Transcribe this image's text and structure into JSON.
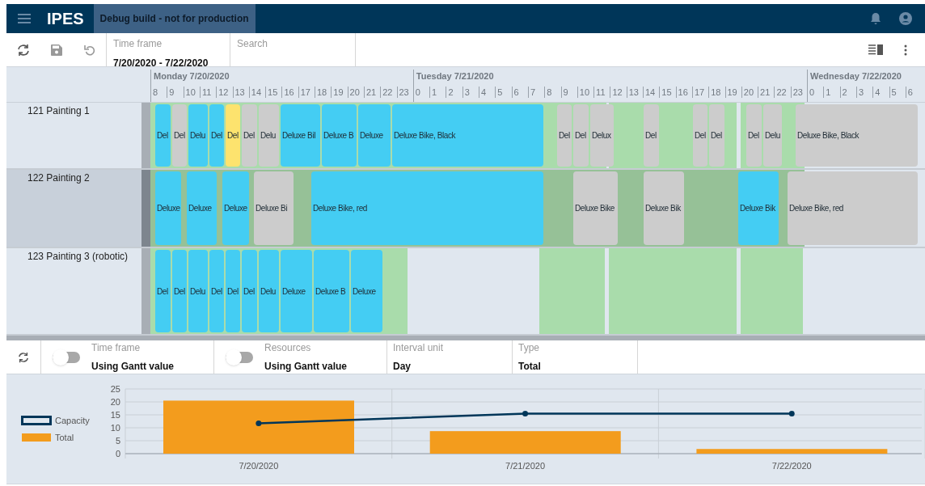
{
  "app_bar": {
    "title": "IPES",
    "badge": "Debug build - not for production"
  },
  "toolbar": {
    "time_frame": {
      "label": "Time frame",
      "value": "7/20/2020 - 7/22/2020"
    },
    "search": {
      "placeholder": "Search"
    }
  },
  "timeline": {
    "days": [
      "Monday 7/20/2020",
      "Tuesday 7/21/2020",
      "Wednesday 7/22/2020"
    ],
    "hours": [
      "8",
      "9",
      "10",
      "11",
      "12",
      "13",
      "14",
      "15",
      "16",
      "17",
      "18",
      "19",
      "20",
      "21",
      "22",
      "23",
      "0",
      "1",
      "2",
      "3",
      "4",
      "5",
      "6",
      "7",
      "8",
      "9",
      "10",
      "11",
      "12",
      "13",
      "14",
      "15",
      "16",
      "17",
      "18",
      "19",
      "20",
      "21",
      "22",
      "23",
      "0",
      "1",
      "2",
      "3",
      "4",
      "5",
      "6"
    ]
  },
  "resources": [
    {
      "name": "121 Painting 1",
      "selected": false,
      "tasks": [
        {
          "label": "Del",
          "color": "#44cdf3"
        },
        {
          "label": "Del",
          "color": "#cccccc"
        },
        {
          "label": "Delu",
          "color": "#44cdf3"
        },
        {
          "label": "Del",
          "color": "#44cdf3"
        },
        {
          "label": "Del",
          "color": "#fde36e"
        },
        {
          "label": "Del",
          "color": "#cccccc"
        },
        {
          "label": "Delu",
          "color": "#cccccc"
        },
        {
          "label": "Deluxe Bil",
          "color": "#44cdf3"
        },
        {
          "label": "Deluxe B",
          "color": "#44cdf3"
        },
        {
          "label": "Deluxe",
          "color": "#44cdf3"
        },
        {
          "label": "Deluxe Bike, Black",
          "color": "#44cdf3"
        },
        {
          "label": "Del",
          "color": "#cccccc"
        },
        {
          "label": "Del",
          "color": "#cccccc"
        },
        {
          "label": "Delux",
          "color": "#cccccc"
        },
        {
          "label": "Del",
          "color": "#cccccc"
        },
        {
          "label": "Del",
          "color": "#cccccc"
        },
        {
          "label": "Del",
          "color": "#cccccc"
        },
        {
          "label": "Del",
          "color": "#cccccc"
        },
        {
          "label": "Delu",
          "color": "#cccccc"
        },
        {
          "label": "Deluxe Bike, Black",
          "color": "#cccccc"
        }
      ]
    },
    {
      "name": "122 Painting 2",
      "selected": true,
      "tasks": [
        {
          "label": "Deluxe",
          "color": "#44cdf3"
        },
        {
          "label": "Deluxe",
          "color": "#44cdf3"
        },
        {
          "label": "Deluxe",
          "color": "#44cdf3"
        },
        {
          "label": "Deluxe Bi",
          "color": "#cccccc"
        },
        {
          "label": "Deluxe Bike, red",
          "color": "#44cdf3"
        },
        {
          "label": "Deluxe Bike",
          "color": "#cccccc"
        },
        {
          "label": "Deluxe Bik",
          "color": "#cccccc"
        },
        {
          "label": "Deluxe Bik",
          "color": "#44cdf3"
        },
        {
          "label": "Deluxe Bike, red",
          "color": "#cccccc"
        }
      ]
    },
    {
      "name": "123 Painting 3 (robotic)",
      "selected": false,
      "tasks": [
        {
          "label": "Del",
          "color": "#44cdf3"
        },
        {
          "label": "Del",
          "color": "#44cdf3"
        },
        {
          "label": "Delu",
          "color": "#44cdf3"
        },
        {
          "label": "Del",
          "color": "#44cdf3"
        },
        {
          "label": "Del",
          "color": "#44cdf3"
        },
        {
          "label": "Del",
          "color": "#44cdf3"
        },
        {
          "label": "Delu",
          "color": "#44cdf3"
        },
        {
          "label": "Deluxe",
          "color": "#44cdf3"
        },
        {
          "label": "Deluxe B",
          "color": "#44cdf3"
        },
        {
          "label": "Deluxe",
          "color": "#44cdf3"
        }
      ]
    }
  ],
  "filters": [
    {
      "kind": "toggle",
      "label": "Time frame",
      "value": "Using Gantt value",
      "on": false
    },
    {
      "kind": "toggle",
      "label": "Resources",
      "value": "Using Gantt value",
      "on": false
    },
    {
      "kind": "field",
      "label": "Interval unit",
      "value": "Day"
    },
    {
      "kind": "field",
      "label": "Type",
      "value": "Total"
    }
  ],
  "chart_data": {
    "type": "bar",
    "categories": [
      "7/20/2020",
      "7/21/2020",
      "7/22/2020"
    ],
    "ylim": [
      0,
      25
    ],
    "yticks": [
      0,
      5,
      10,
      15,
      20,
      25
    ],
    "grid": true,
    "legend": true,
    "series": [
      {
        "name": "Capacity",
        "color": "#003659",
        "type": "line",
        "marker": "circle",
        "values": [
          11.7,
          15.5,
          15.5
        ]
      },
      {
        "name": "Total",
        "color": "#f39c1d",
        "type": "bar",
        "values": [
          20.5,
          8.7,
          1.8
        ]
      }
    ]
  }
}
